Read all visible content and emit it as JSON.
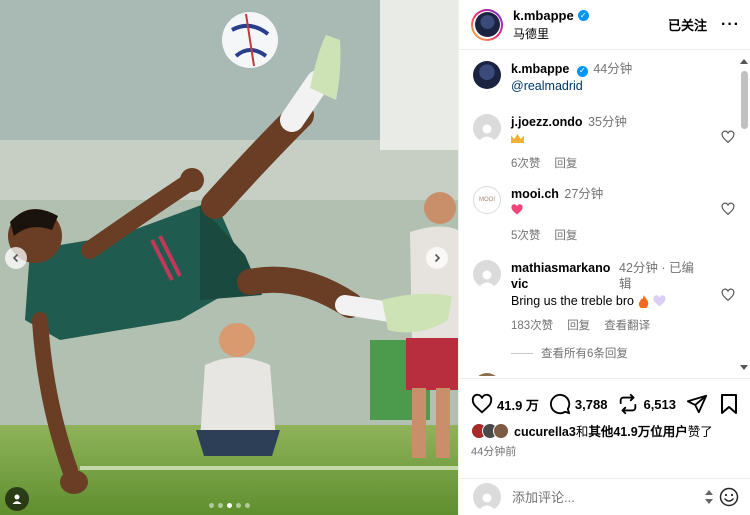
{
  "post": {
    "author": "k.mbappe",
    "location": "马德里",
    "follow_state": "已关注",
    "more_label": "···"
  },
  "caption": {
    "username": "k.mbappe",
    "time": "44分钟",
    "text": "@realmadrid"
  },
  "comments": [
    {
      "username": "j.joezz.ondo",
      "time": "35分钟",
      "text_icon": "crown-emoji",
      "likes": "6次赞",
      "reply": "回复"
    },
    {
      "username": "mooi.ch",
      "time": "27分钟",
      "text_icon": "pink-heart-emoji",
      "likes": "5次赞",
      "reply": "回复",
      "avatar_text": "MOOI"
    },
    {
      "username_line1": "mathiasmarkano",
      "username_line2": "vic",
      "time": "42分钟 · 已编",
      "time_line2": "辑",
      "text": "Bring us the treble bro",
      "likes": "183次赞",
      "reply": "回复",
      "translate": "查看翻译"
    }
  ],
  "view_replies": "查看所有6条回复",
  "partial_next_comment": "",
  "actions": {
    "likes_count": "41.9 万",
    "comments_count": "3,788",
    "shares_count": "6,513"
  },
  "liked_by": {
    "name": "cucurella3",
    "middle": "和",
    "others": "其他41.9万位用户",
    "suffix": "赞了"
  },
  "time_ago": "44分钟前",
  "composer": {
    "placeholder": "添加评论..."
  },
  "colors": {
    "verified": "#0095f6",
    "secondary_text": "#737373",
    "link": "#00376b",
    "pitch_green": "#6c9a3c",
    "kit_teal": "#1f5b4f"
  }
}
